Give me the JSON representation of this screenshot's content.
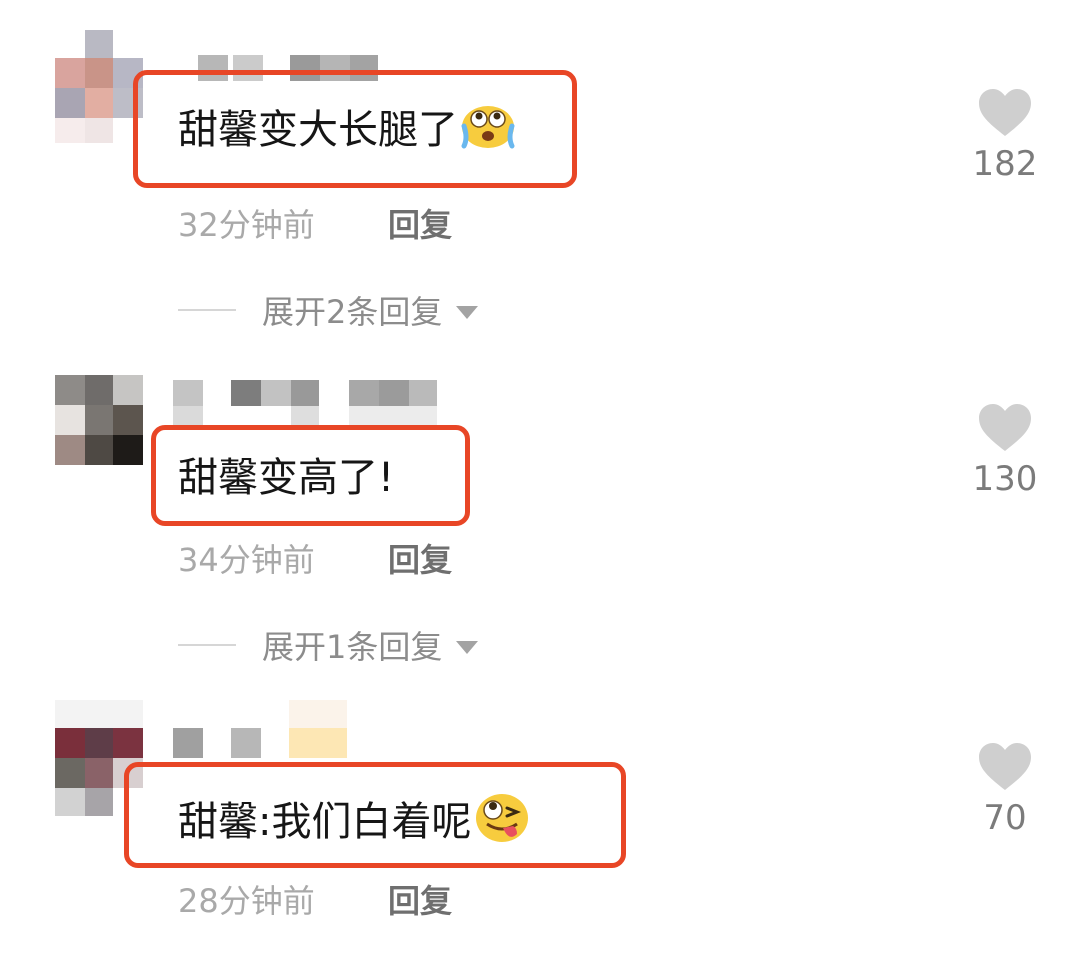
{
  "colors": {
    "highlight": "#e84626",
    "text": "#161616",
    "muted": "#a9a9a9",
    "heart": "#cfcfcf"
  },
  "comments": [
    {
      "text": "甜馨变大长腿了",
      "emoji": "crying-emoji",
      "time": "32分钟前",
      "reply_label": "回复",
      "expand_label": "展开2条回复",
      "likes": "182"
    },
    {
      "text": "甜馨变高了!",
      "emoji": "",
      "time": "34分钟前",
      "reply_label": "回复",
      "expand_label": "展开1条回复",
      "likes": "130"
    },
    {
      "text": "甜馨:我们白着呢",
      "emoji": "tongue-wink-emoji",
      "time": "28分钟前",
      "reply_label": "回复",
      "likes": "70"
    }
  ]
}
